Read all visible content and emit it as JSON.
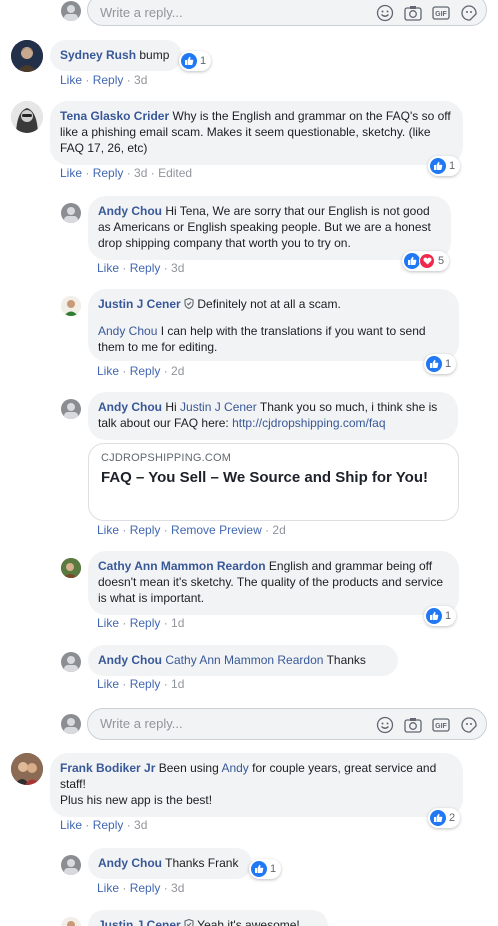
{
  "reply_placeholder": "Write a reply...",
  "comments": {
    "sydney": {
      "author": "Sydney Rush",
      "text": "bump",
      "likes": "1",
      "actions": {
        "like": "Like",
        "reply": "Reply",
        "time": "3d"
      }
    },
    "tena": {
      "author": "Tena Glasko Crider",
      "text": "Why is the English and grammar on the FAQ's so off like a phishing email scam. Makes it seem questionable, sketchy. (like FAQ 17, 26, etc)",
      "likes": "1",
      "actions": {
        "like": "Like",
        "reply": "Reply",
        "time": "3d",
        "edited": "Edited"
      }
    },
    "andy1": {
      "author": "Andy Chou",
      "text": "Hi Tena, We are sorry that our English is not good as Americans or English speaking people. But we are a honest drop shipping company that worth you to try on.",
      "likes": "5",
      "actions": {
        "like": "Like",
        "reply": "Reply",
        "time": "3d"
      }
    },
    "justin1": {
      "author": "Justin J Cener",
      "line1": "Definitely not at all a scam.",
      "mention": "Andy Chou",
      "line2": "I can help with the translations if you want to send them to me for editing.",
      "likes": "1",
      "actions": {
        "like": "Like",
        "reply": "Reply",
        "time": "2d"
      }
    },
    "andy2": {
      "author": "Andy Chou",
      "pre": "Hi",
      "mention": "Justin J Cener",
      "post": "Thank you so much, i think she is talk about our FAQ here:",
      "url": "http://cjdropshipping.com/faq",
      "preview": {
        "domain": "CJDROPSHIPPING.COM",
        "title": "FAQ – You Sell – We Source and Ship for You!"
      },
      "actions": {
        "like": "Like",
        "reply": "Reply",
        "remove": "Remove Preview",
        "time": "2d"
      }
    },
    "cathy": {
      "author": "Cathy Ann Mammon Reardon",
      "text": "English and grammar being off doesn't mean it's sketchy. The quality of the products and service is what is important.",
      "likes": "1",
      "actions": {
        "like": "Like",
        "reply": "Reply",
        "time": "1d"
      }
    },
    "andy3": {
      "author": "Andy Chou",
      "mention": "Cathy Ann Mammon Reardon",
      "text": "Thanks",
      "actions": {
        "like": "Like",
        "reply": "Reply",
        "time": "1d"
      }
    },
    "frank": {
      "author": "Frank Bodiker Jr",
      "pre": "Been using",
      "mention": "Andy",
      "post": "for couple years, great service and staff!",
      "line2": "Plus his new app is the best!",
      "likes": "2",
      "actions": {
        "like": "Like",
        "reply": "Reply",
        "time": "3d"
      }
    },
    "andy4": {
      "author": "Andy Chou",
      "text": "Thanks Frank",
      "likes": "1",
      "actions": {
        "like": "Like",
        "reply": "Reply",
        "time": "3d"
      }
    },
    "justin2": {
      "author": "Justin J Cener",
      "text": "Yeah it's awesome!"
    }
  },
  "colors": {
    "author": "#385898",
    "bubble": "#f2f3f5",
    "like_blue": "#2078f4",
    "love_red": "#f0284a",
    "action": "#4267b2",
    "muted": "#90949c"
  },
  "icons": [
    "emoji-icon",
    "camera-icon",
    "gif-icon",
    "sticker-icon",
    "like-reaction-icon",
    "love-reaction-icon",
    "verified-shield-icon"
  ]
}
